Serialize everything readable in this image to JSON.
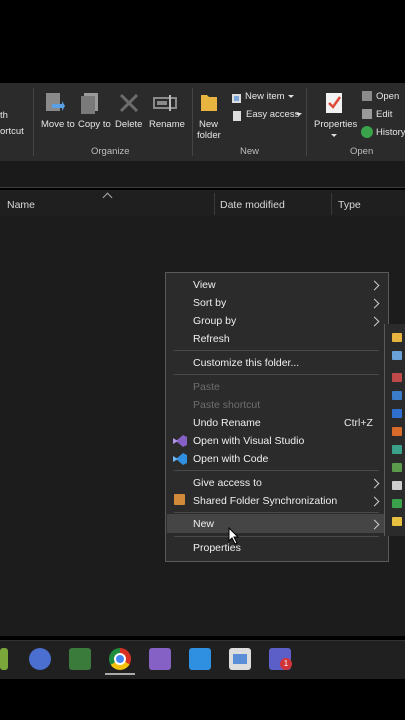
{
  "ribbon": {
    "left_clip": {
      "line1": "th",
      "line2": "ortcut"
    },
    "move_to": "Move to",
    "copy_to": "Copy to",
    "delete": "Delete",
    "rename": "Rename",
    "new_folder_line1": "New",
    "new_folder_line2": "folder",
    "new_item": "New item",
    "easy_access": "Easy access",
    "properties": "Properties",
    "open": "Open",
    "edit": "Edit",
    "history": "History",
    "groups": {
      "organize": "Organize",
      "new": "New",
      "open": "Open"
    }
  },
  "columns": [
    "Name",
    "Date modified",
    "Type"
  ],
  "context_menu": {
    "view": "View",
    "sort_by": "Sort by",
    "group_by": "Group by",
    "refresh": "Refresh",
    "customize": "Customize this folder...",
    "paste": "Paste",
    "paste_shortcut": "Paste shortcut",
    "undo_rename": "Undo Rename",
    "undo_shortcut": "Ctrl+Z",
    "open_vs": "Open with Visual Studio",
    "open_code": "Open with Code",
    "give_access": "Give access to",
    "shared_sync": "Shared Folder Synchronization",
    "new": "New",
    "properties": "Properties"
  },
  "taskbar": {
    "teams_badge": "1"
  },
  "colors": {
    "accent_yellow": "#e8b440",
    "vs_purple": "#8661c5",
    "vscode_blue": "#2f8fe0",
    "teams_purple": "#5b5fc7"
  }
}
